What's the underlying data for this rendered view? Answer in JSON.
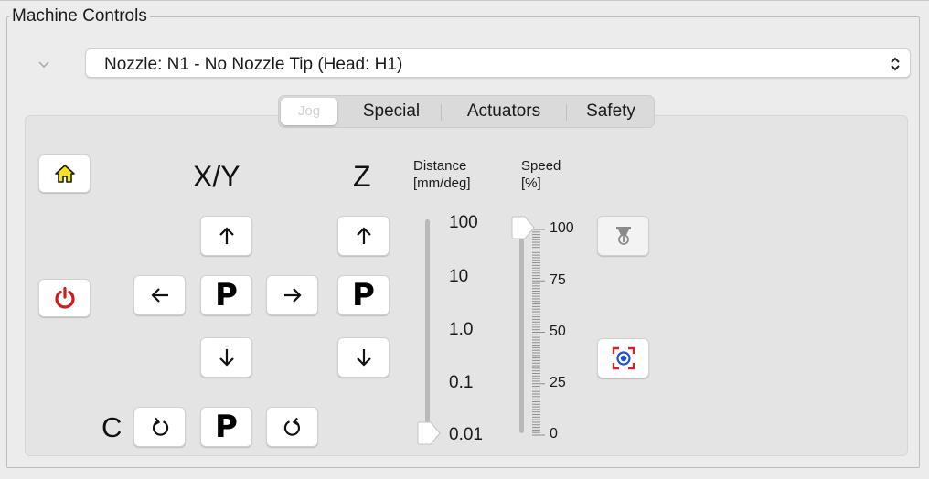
{
  "group_title": "Machine Controls",
  "nozzle_select": {
    "value": "Nozzle: N1 - No Nozzle Tip (Head: H1)"
  },
  "tabs": [
    {
      "label": "Jog",
      "active": true
    },
    {
      "label": "Special",
      "active": false
    },
    {
      "label": "Actuators",
      "active": false
    },
    {
      "label": "Safety",
      "active": false
    }
  ],
  "jog": {
    "xy_label": "X/Y",
    "z_label": "Z",
    "c_label": "C",
    "park_label": "P",
    "distance": {
      "label": "Distance",
      "unit": "[mm/deg]",
      "values": [
        "100",
        "10",
        "1.0",
        "0.1",
        "0.01"
      ],
      "selected": "0.01"
    },
    "speed": {
      "label": "Speed",
      "unit": "[%]",
      "ticks": [
        "100",
        "75",
        "50",
        "25",
        "0"
      ],
      "value": 100
    }
  },
  "icons": {
    "home": "home-icon",
    "power": "power-icon",
    "nozzle": "nozzle-icon",
    "target": "camera-target-icon"
  },
  "colors": {
    "home_icon_fill": "#f6e21a",
    "power_icon": "#cc1e1e",
    "target_blue": "#1f4fd6",
    "target_red": "#d32525"
  }
}
